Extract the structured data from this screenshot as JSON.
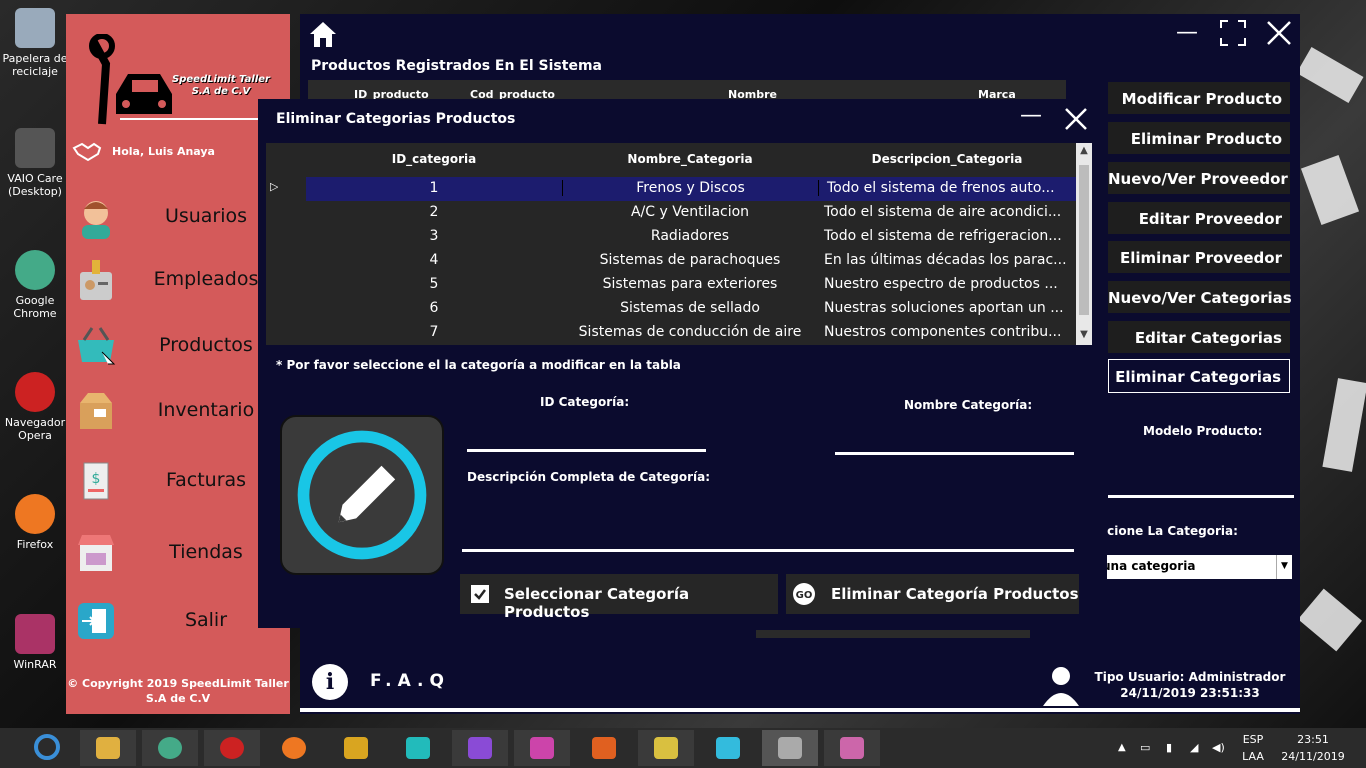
{
  "desktop": {
    "icons": [
      {
        "label": "Papelera de reciclaje",
        "color": "#9ab"
      },
      {
        "label": "VAIO Care (Desktop)",
        "color": "#555"
      },
      {
        "label": "Google Chrome",
        "color": "#4a8"
      },
      {
        "label": "Navegador Opera",
        "color": "#c22"
      },
      {
        "label": "Firefox",
        "color": "#e72"
      },
      {
        "label": "WinRAR",
        "color": "#a36"
      }
    ]
  },
  "sidebar": {
    "logo_text": "SpeedLimit Taller S.A de C.V",
    "greeting": "Hola, Luis Anaya",
    "items": [
      {
        "label": "Usuarios",
        "icon": "user-icon"
      },
      {
        "label": "Empleados",
        "icon": "badge-icon"
      },
      {
        "label": "Productos",
        "icon": "basket-icon"
      },
      {
        "label": "Inventario",
        "icon": "box-icon"
      },
      {
        "label": "Facturas",
        "icon": "invoice-icon"
      },
      {
        "label": "Tiendas",
        "icon": "store-icon"
      },
      {
        "label": "Salir",
        "icon": "exit-icon"
      }
    ],
    "copyright": "© Copyright 2019 SpeedLimit Taller S.A de C.V"
  },
  "main": {
    "title": "Productos Registrados En El Sistema",
    "table_headers": [
      "ID_producto",
      "Cod_producto",
      "Nombre",
      "Marca"
    ],
    "buttons": [
      "Modificar Producto",
      "Eliminar Producto",
      "Nuevo/Ver Proveedor",
      "Editar Proveedor",
      "Eliminar Proveedor",
      "Nuevo/Ver Categorias",
      "Editar Categorias",
      "Eliminar Categorias"
    ],
    "modelo_label": "Modelo Producto:",
    "select_category_label": "ccione La Categoria:",
    "category_combo_value": "una categoria",
    "faq": "F.A.Q",
    "user_type": "Tipo Usuario: Administrador",
    "datetime": "24/11/2019 23:51:33"
  },
  "dialog": {
    "title": "Eliminar Categorias Productos",
    "columns": [
      "ID_categoria",
      "Nombre_Categoria",
      "Descripcion_Categoria"
    ],
    "rows": [
      {
        "id": "1",
        "name": "Frenos y Discos",
        "desc": "Todo el sistema de frenos auto..."
      },
      {
        "id": "2",
        "name": "A/C y Ventilacion",
        "desc": "Todo el sistema de aire acondici..."
      },
      {
        "id": "3",
        "name": "Radiadores",
        "desc": "Todo el sistema de refrigeracion..."
      },
      {
        "id": "4",
        "name": "Sistemas de parachoques",
        "desc": "En las últimas décadas los parac..."
      },
      {
        "id": "5",
        "name": "Sistemas para exteriores",
        "desc": "Nuestro espectro de productos ..."
      },
      {
        "id": "6",
        "name": "Sistemas de sellado",
        "desc": "Nuestras soluciones aportan un ..."
      },
      {
        "id": "7",
        "name": "Sistemas de conducción de aire",
        "desc": "Nuestros componentes contribu..."
      }
    ],
    "note": "* Por favor seleccione el la categoría a modificar en la tabla",
    "id_label": "ID Categoría:",
    "name_label": "Nombre Categoría:",
    "desc_label": "Descripción Completa de Categoría:",
    "select_button": "Seleccionar Categoría Productos",
    "delete_button": "Eliminar Categoría Productos"
  },
  "taskbar": {
    "lang": "ESP",
    "layout": "LAA",
    "time": "23:51",
    "date": "24/11/2019",
    "apps": [
      "#3a8fd8",
      "#e0b040",
      "#4a8",
      "#c22",
      "#e72",
      "#d9a520",
      "#2bb",
      "#8a4bd6",
      "#c4a",
      "#e06020",
      "#d9c040",
      "#3bd",
      "#aaa",
      "#c6a"
    ]
  }
}
